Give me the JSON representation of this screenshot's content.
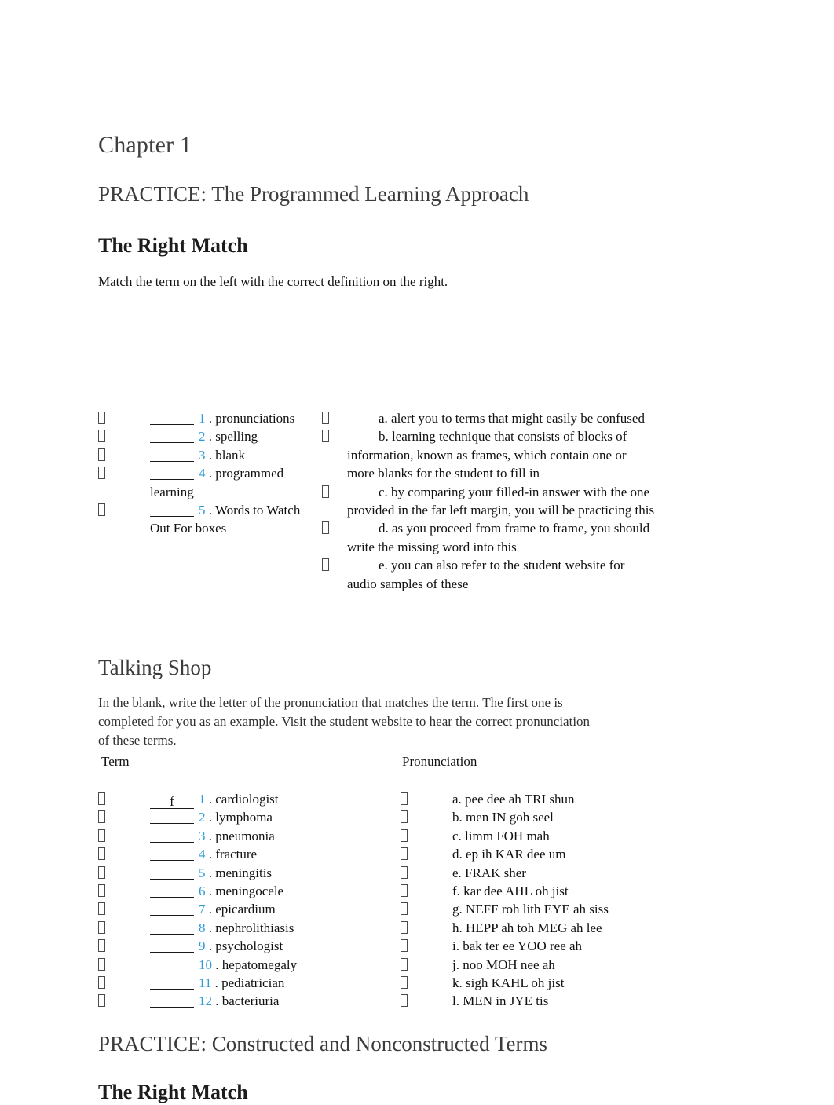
{
  "document": {
    "chapter_title": "Chapter 1",
    "practice_heading_1": "PRACTICE: The Programmed Learning Approach",
    "practice_heading_2": "PRACTICE: Constructed and Nonconstructed Terms"
  },
  "right_match_1": {
    "section_title": "The Right Match",
    "instructions": "Match the term on the left with the correct definition on the right.",
    "marker_glyph": "missing-glyph-box",
    "terms": [
      {
        "blank": "______",
        "number": "1",
        "separator": ".",
        "text": "pronunciations"
      },
      {
        "blank": "______",
        "number": "2",
        "separator": ".",
        "text": "spelling"
      },
      {
        "blank": "______",
        "number": "3",
        "separator": ".",
        "text": "blank"
      },
      {
        "blank": "______",
        "number": "4",
        "separator": ".",
        "text": "programmed learning"
      },
      {
        "blank": "______",
        "number": "5",
        "separator": ".",
        "text": "Words to Watch Out For boxes"
      }
    ],
    "definitions": [
      {
        "letter": "a.",
        "text": "alert you to terms that might easily be confused"
      },
      {
        "letter": "b.",
        "text": "learning technique that consists of blocks of information, known as frames, which contain one or more blanks for the student to fill in"
      },
      {
        "letter": "c.",
        "text": "by comparing your filled-in answer with the one provided in the far left margin, you will be practicing this"
      },
      {
        "letter": "d.",
        "text": "as you proceed from frame to frame, you should write the missing word into this"
      },
      {
        "letter": "e.",
        "text": "you can also refer to the student website for audio samples of these"
      }
    ]
  },
  "talking_shop": {
    "section_title": "Talking Shop",
    "instructions": "In the blank, write the letter of the pronunciation that matches the term. The first one is completed for you as an example. Visit the student website to hear the correct pronunciation of these terms.",
    "column_headers": {
      "term": "Term",
      "pronunciation": "Pronunciation"
    },
    "terms": [
      {
        "blank": "___f__",
        "number": "1",
        "separator": ".",
        "text": "cardiologist"
      },
      {
        "blank": "______",
        "number": "2",
        "separator": ".",
        "text": "lymphoma"
      },
      {
        "blank": "______",
        "number": "3",
        "separator": ".",
        "text": "pneumonia"
      },
      {
        "blank": "______",
        "number": "4",
        "separator": ".",
        "text": "fracture"
      },
      {
        "blank": "______",
        "number": "5",
        "separator": ".",
        "text": "meningitis"
      },
      {
        "blank": "______",
        "number": "6",
        "separator": ".",
        "text": "meningocele"
      },
      {
        "blank": "______",
        "number": "7",
        "separator": ".",
        "text": "epicardium"
      },
      {
        "blank": "______",
        "number": "8",
        "separator": ".",
        "text": "nephrolithiasis"
      },
      {
        "blank": "______",
        "number": "9",
        "separator": ".",
        "text": "psychologist"
      },
      {
        "blank": "______",
        "number": "10",
        "separator": ".",
        "text": "hepatomegaly"
      },
      {
        "blank": "______",
        "number": "11",
        "separator": ".",
        "text": "pediatrician"
      },
      {
        "blank": "______",
        "number": "12",
        "separator": ".",
        "text": "bacteriuria"
      }
    ],
    "pronunciations": [
      {
        "letter": "a.",
        "text": "pee dee ah TRI shun"
      },
      {
        "letter": "b.",
        "text": "men IN goh seel"
      },
      {
        "letter": "c.",
        "text": "limm FOH mah"
      },
      {
        "letter": "d.",
        "text": "ep ih KAR dee um"
      },
      {
        "letter": "e.",
        "text": "FRAK sher"
      },
      {
        "letter": "f.",
        "text": "kar dee AHL oh jist"
      },
      {
        "letter": "g.",
        "text": "NEFF roh lith EYE ah siss"
      },
      {
        "letter": "h.",
        "text": "HEPP ah toh MEG ah lee"
      },
      {
        "letter": "i.",
        "text": "bak ter ee YOO ree ah"
      },
      {
        "letter": "j.",
        "text": "noo MOH nee ah"
      },
      {
        "letter": "k.",
        "text": "sigh KAHL oh jist"
      },
      {
        "letter": "l.",
        "text": "MEN in JYE tis"
      }
    ]
  },
  "right_match_2": {
    "section_title": "The Right Match"
  },
  "colors": {
    "number_accent": "#2f9ad4",
    "heading_gray": "#3c3c3c",
    "body_text": "#111111",
    "page_background": "#ffffff"
  }
}
